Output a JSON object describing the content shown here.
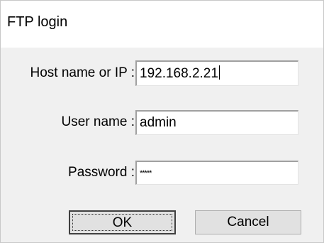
{
  "window": {
    "title": "FTP login"
  },
  "form": {
    "host_label": "Host name or IP :",
    "host_value": "192.168.2.21",
    "user_label": "User name :",
    "user_value": "admin",
    "password_label": "Password :",
    "password_value": "*****"
  },
  "buttons": {
    "ok_label": "OK",
    "cancel_label": "Cancel"
  }
}
